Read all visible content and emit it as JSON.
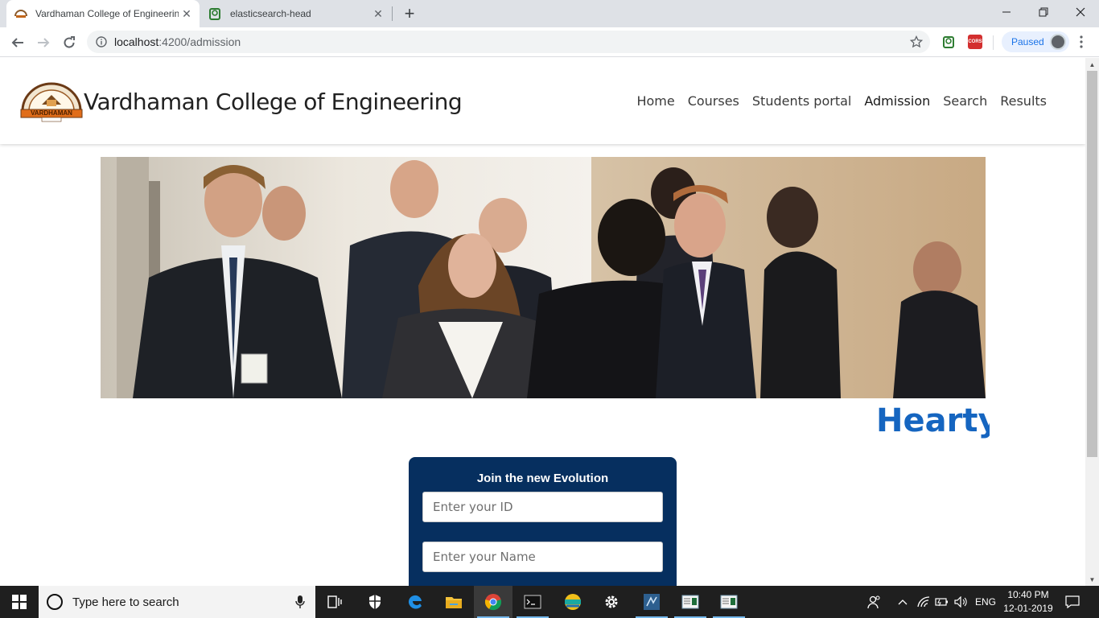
{
  "browser": {
    "tabs": [
      {
        "title": "Vardhaman College of Engineerin",
        "active": true,
        "icon": "site-logo-icon"
      },
      {
        "title": "elasticsearch-head",
        "active": false,
        "icon": "elasticsearch-head-icon"
      }
    ],
    "url_host": "localhost",
    "url_path": ":4200/admission",
    "profile_label": "Paused",
    "extension_label": "CORS"
  },
  "site": {
    "brand": "Vardhaman College of Engineering",
    "logo_text": "VARDHAMAN",
    "nav": [
      {
        "label": "Home"
      },
      {
        "label": "Courses"
      },
      {
        "label": "Students portal"
      },
      {
        "label": "Admission"
      },
      {
        "label": "Search"
      },
      {
        "label": "Results"
      }
    ],
    "marquee_text": "Hearty w",
    "form": {
      "title": "Join the new Evolution",
      "id_placeholder": "Enter your ID",
      "name_placeholder": "Enter your Name"
    },
    "colors": {
      "marquee": "#1565c0",
      "form_bg": "#062f5f"
    }
  },
  "taskbar": {
    "search_placeholder": "Type here to search",
    "language": "ENG",
    "time": "10:40 PM",
    "date": "12-01-2019"
  }
}
